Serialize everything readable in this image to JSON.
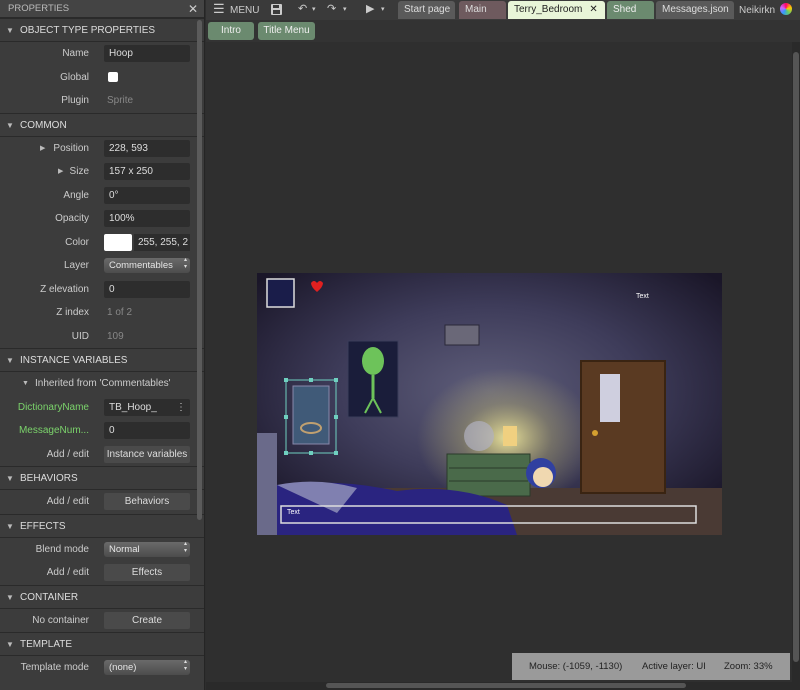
{
  "props_panel": {
    "title": "PROPERTIES",
    "sections": {
      "object_type": "OBJECT TYPE PROPERTIES",
      "common": "COMMON",
      "instance_vars": "INSTANCE VARIABLES",
      "behaviors": "BEHAVIORS",
      "effects": "EFFECTS",
      "container": "CONTAINER",
      "template": "TEMPLATE"
    },
    "name_label": "Name",
    "name_value": "Hoop",
    "global_label": "Global",
    "global_checked": false,
    "plugin_label": "Plugin",
    "plugin_value": "Sprite",
    "position_label": "Position",
    "position_value": "228, 593",
    "size_label": "Size",
    "size_value": "157 x 250",
    "angle_label": "Angle",
    "angle_value": "0°",
    "opacity_label": "Opacity",
    "opacity_value": "100%",
    "color_label": "Color",
    "color_value": "255, 255, 2",
    "color_swatch": "#ffffff",
    "layer_label": "Layer",
    "layer_value": "Commentables",
    "zelev_label": "Z elevation",
    "zelev_value": "0",
    "zindex_label": "Z index",
    "zindex_value": "1 of 2",
    "uid_label": "UID",
    "uid_value": "109",
    "inherited_label": "Inherited from 'Commentables'",
    "dict_label": "DictionaryName",
    "dict_value": "TB_Hoop_",
    "msgnum_label": "MessageNum...",
    "msgnum_value": "0",
    "add_edit": "Add / edit",
    "instance_vars_btn": "Instance variables",
    "behaviors_btn": "Behaviors",
    "blend_label": "Blend mode",
    "blend_value": "Normal",
    "effects_btn": "Effects",
    "no_container": "No container",
    "create_btn": "Create",
    "template_mode_label": "Template mode",
    "template_mode_value": "(none)"
  },
  "toolbar": {
    "menu": "MENU",
    "user": "Neikirkn"
  },
  "tabs": [
    {
      "label": "Start page",
      "bg": "#5a5a5a",
      "fg": "#dddddd"
    },
    {
      "label": "Main",
      "bg": "#6e5a5e",
      "fg": "#dddddd"
    },
    {
      "label": "Terry_Bedroom",
      "bg": "#e8f5d8",
      "fg": "#222222",
      "close": "✕"
    },
    {
      "label": "Shed",
      "bg": "#6b8a6f",
      "fg": "#eeeeee"
    },
    {
      "label": "Messages.json",
      "bg": "#5a5a5a",
      "fg": "#dddddd"
    }
  ],
  "subtabs": [
    "Intro",
    "Title Menu"
  ],
  "scene": {
    "text_top": "Text",
    "text_box": "Text"
  },
  "status": {
    "mouse": "Mouse: (-1059, -1130)",
    "layer": "Active layer: UI",
    "zoom": "Zoom: 33%"
  }
}
